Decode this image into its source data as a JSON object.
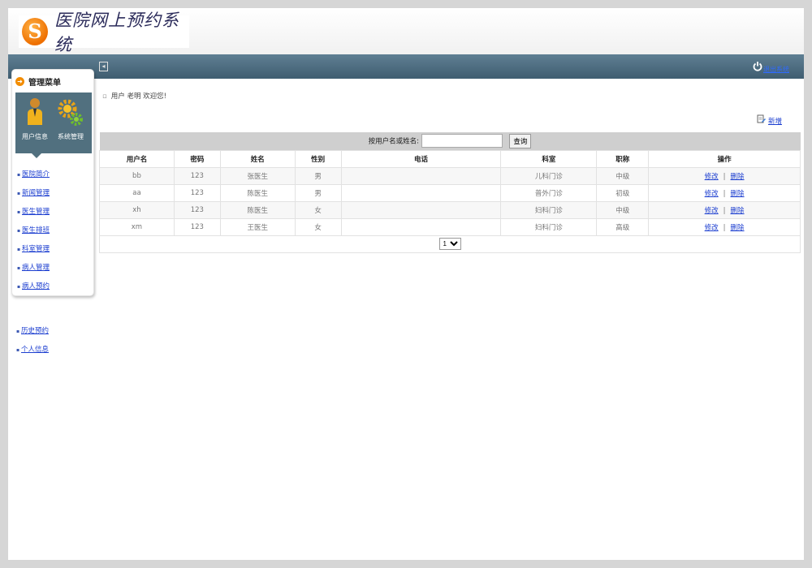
{
  "header": {
    "logo_letter": "S",
    "title": "医院网上预约系统"
  },
  "topbar": {
    "collapse_icon": "collapse-icon",
    "logout_label": "退出系统"
  },
  "sidebar": {
    "title": "管理菜单",
    "roles": [
      {
        "label": "用户信息",
        "icon": "user-icon"
      },
      {
        "label": "系统管理",
        "icon": "gear-icon"
      }
    ],
    "items": [
      "医院简介",
      "新闻管理",
      "医生管理",
      "医生排班",
      "科室管理",
      "病人管理",
      "病人预约",
      "历史预约",
      "个人信息"
    ]
  },
  "main": {
    "welcome": "用户 老明 欢迎您!",
    "add_label": "新增",
    "search": {
      "label": "按用户名或姓名:",
      "value": "",
      "button": "查询"
    },
    "columns": [
      "用户名",
      "密码",
      "姓名",
      "性别",
      "电话",
      "科室",
      "职称",
      "操作"
    ],
    "rows": [
      {
        "username": "bb",
        "password": "123",
        "name": "张医生",
        "gender": "男",
        "phone": "",
        "department": "儿科门诊",
        "title": "中级"
      },
      {
        "username": "aa",
        "password": "123",
        "name": "陈医生",
        "gender": "男",
        "phone": "",
        "department": "普外门诊",
        "title": "初级"
      },
      {
        "username": "xh",
        "password": "123",
        "name": "陈医生",
        "gender": "女",
        "phone": "",
        "department": "妇科门诊",
        "title": "中级"
      },
      {
        "username": "xm",
        "password": "123",
        "name": "王医生",
        "gender": "女",
        "phone": "",
        "department": "妇科门诊",
        "title": "高级"
      }
    ],
    "row_actions": {
      "edit": "修改",
      "delete": "删除",
      "separator": "|"
    },
    "pager": {
      "current_page": "1"
    }
  },
  "colors": {
    "topbar": "#4e6d80",
    "link": "#1d3fd0",
    "logo_accent": "#ee6f00"
  }
}
